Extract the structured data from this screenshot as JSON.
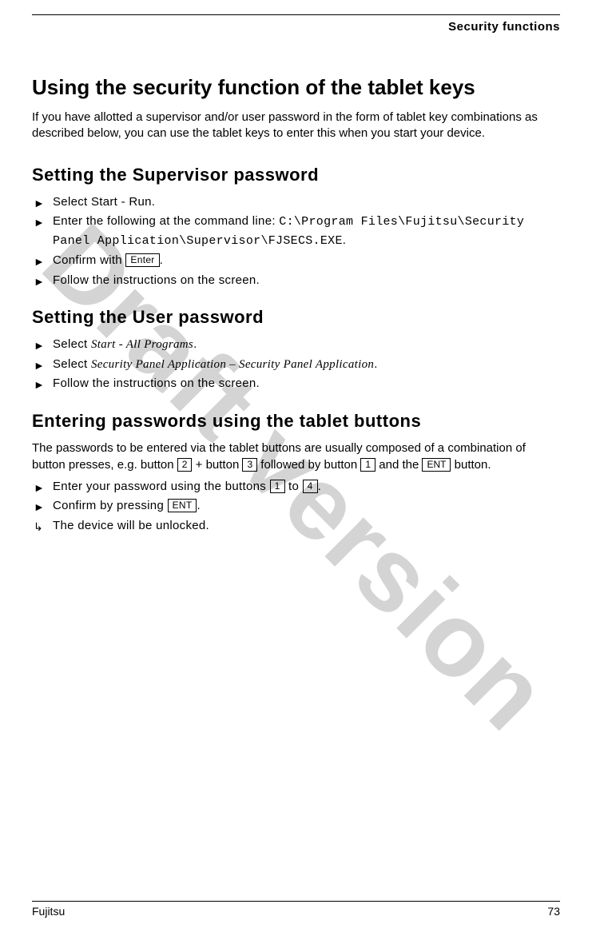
{
  "header": {
    "section": "Security functions"
  },
  "watermark": "Draft version",
  "h1": "Using the security function of the tablet keys",
  "intro": "If you have allotted a supervisor and/or user password in the form of tablet key combinations as described below, you can use the tablet keys to enter this when you start your device.",
  "section1": {
    "title": "Setting the Supervisor password",
    "step1": "Select Start - Run.",
    "step2_prefix": "Enter the following at the command line: ",
    "step2_cmd": "C:\\Program Files\\Fujitsu\\Security Panel Application\\Supervisor\\FJSECS.EXE",
    "step2_suffix": ".",
    "step3_prefix": "Confirm with ",
    "step3_key": "Enter",
    "step3_suffix": ".",
    "step4": "Follow the instructions on the screen."
  },
  "section2": {
    "title": "Setting the User password",
    "step1_prefix": "Select ",
    "step1_menu": "Start - All Programs",
    "step1_suffix": ".",
    "step2_prefix": "Select ",
    "step2_menu": "Security Panel Application – Security Panel Application",
    "step2_suffix": ".",
    "step3": "Follow the instructions on the screen."
  },
  "section3": {
    "title": "Entering passwords using the tablet buttons",
    "para_p1": "The passwords to be entered via the tablet buttons are usually composed of a combination of button presses, e.g. button ",
    "key2": "2",
    "para_p2": " + button ",
    "key3": "3",
    "para_p3": " followed by button ",
    "key1": "1",
    "para_p4": " and the ",
    "keyENT": "ENT",
    "para_p5": " button.",
    "step1_prefix": "Enter your password using the buttons ",
    "step1_k1": "1",
    "step1_mid": " to ",
    "step1_k4": "4",
    "step1_suffix": ".",
    "step2_prefix": "Confirm by pressing ",
    "step2_key": "ENT",
    "step2_suffix": ".",
    "result": "The device will be unlocked."
  },
  "footer": {
    "brand": "Fujitsu",
    "page": "73"
  }
}
